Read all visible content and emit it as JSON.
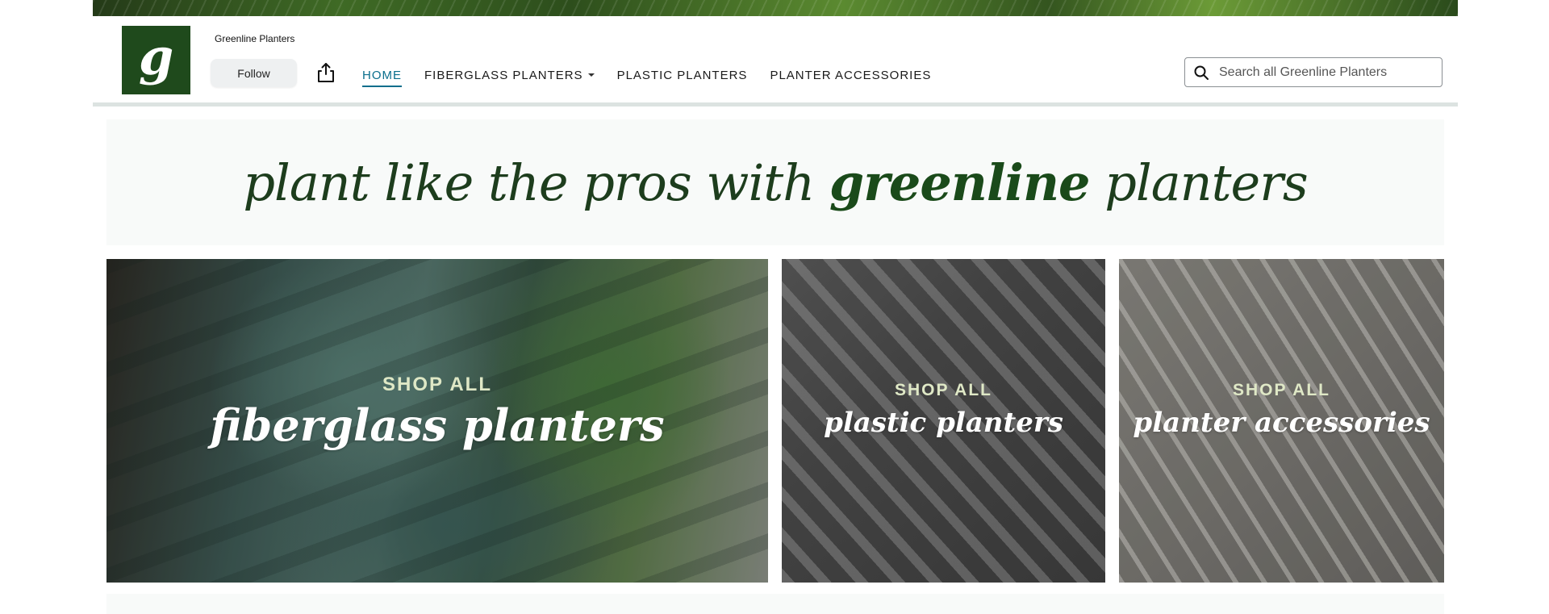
{
  "store": {
    "name": "Greenline Planters",
    "logo_letter": "g",
    "follow_label": "Follow"
  },
  "nav": {
    "items": [
      {
        "label": "HOME",
        "active": true
      },
      {
        "label": "FIBERGLASS PLANTERS",
        "has_dropdown": true
      },
      {
        "label": "PLASTIC PLANTERS"
      },
      {
        "label": "PLANTER ACCESSORIES"
      }
    ]
  },
  "search": {
    "placeholder": "Search all Greenline Planters",
    "value": ""
  },
  "tagline": {
    "before": "plant like the pros with ",
    "brand": "greenline",
    "after": " planters"
  },
  "tiles": [
    {
      "kicker": "SHOP ALL",
      "title": "fiberglass planters"
    },
    {
      "kicker": "SHOP ALL",
      "title": "plastic planters"
    },
    {
      "kicker": "SHOP ALL",
      "title": "planter accessories"
    }
  ],
  "colors": {
    "brand_green": "#1f4a1c",
    "nav_active": "#0a6e8c",
    "tile_kicker": "#dfe8c6"
  },
  "icons": {
    "share": "share-icon",
    "search": "search-icon",
    "dropdown": "chevron-down-icon"
  }
}
